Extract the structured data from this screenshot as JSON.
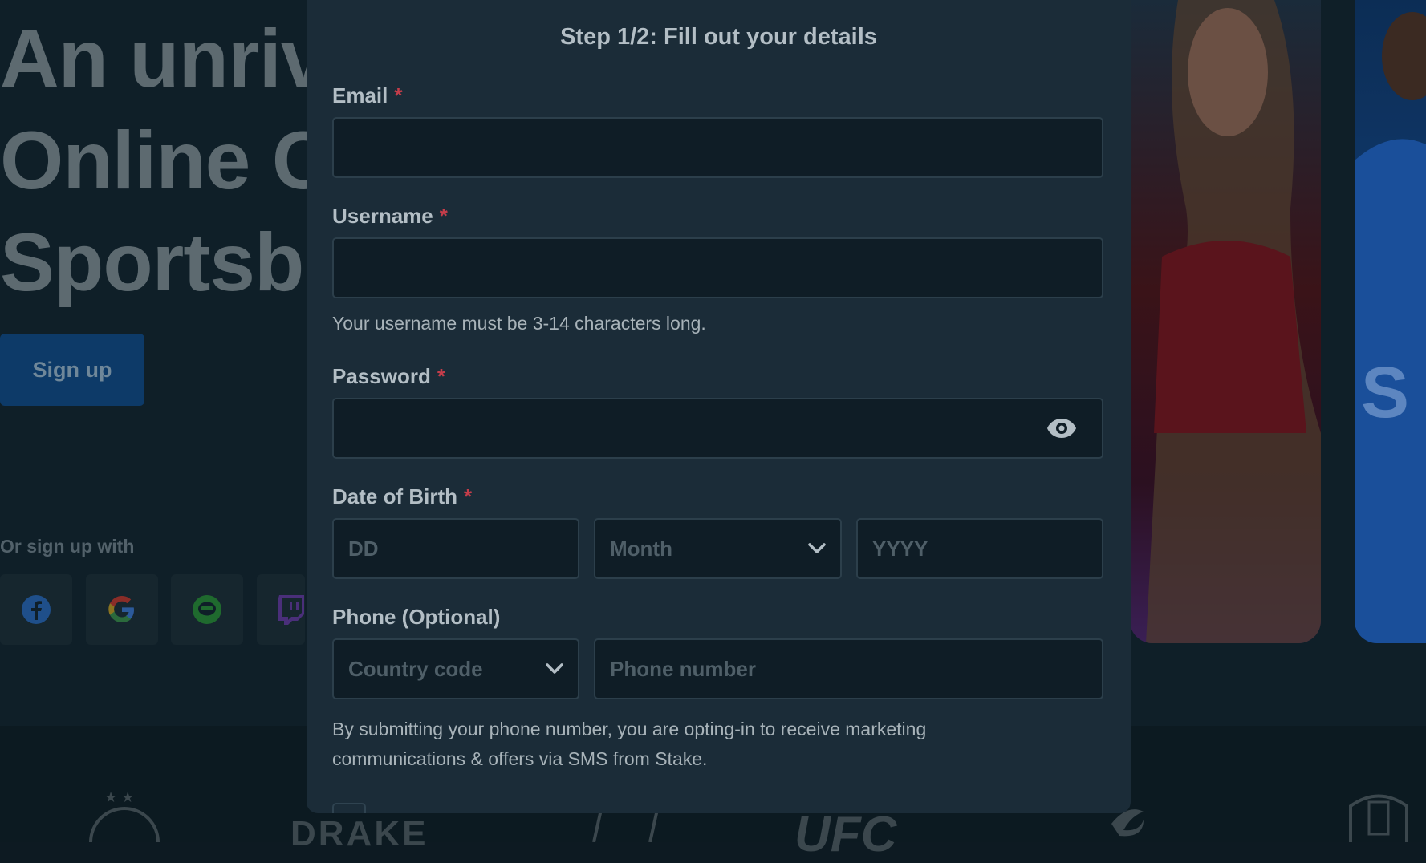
{
  "background": {
    "hero_lines": [
      "An unriv",
      "Online C",
      "Sportsb"
    ],
    "signup_button": "Sign up",
    "or_sign_up_with": "Or sign up with",
    "social_icons": [
      "facebook-icon",
      "google-icon",
      "line-icon",
      "twitch-icon"
    ],
    "bottom_logos": [
      "DRAKE",
      "UFC"
    ]
  },
  "modal": {
    "title": "Step 1/2: Fill out your details",
    "required_mark": "*",
    "email": {
      "label": "Email",
      "value": ""
    },
    "username": {
      "label": "Username",
      "value": "",
      "hint": "Your username must be 3-14 characters long."
    },
    "password": {
      "label": "Password",
      "value": ""
    },
    "dob": {
      "label": "Date of Birth",
      "day_placeholder": "DD",
      "month_placeholder": "Month",
      "year_placeholder": "YYYY"
    },
    "phone": {
      "label": "Phone (Optional)",
      "country_placeholder": "Country code",
      "number_placeholder": "Phone number",
      "disclaimer_line1": "By submitting your phone number, you are opting-in to receive marketing",
      "disclaimer_line2": "communications & offers via SMS from Stake."
    }
  },
  "colors": {
    "modal_bg": "#1b2c38",
    "input_bg": "#0f1d26",
    "required": "#c43d4a",
    "signup_bg": "#0d3a68"
  }
}
